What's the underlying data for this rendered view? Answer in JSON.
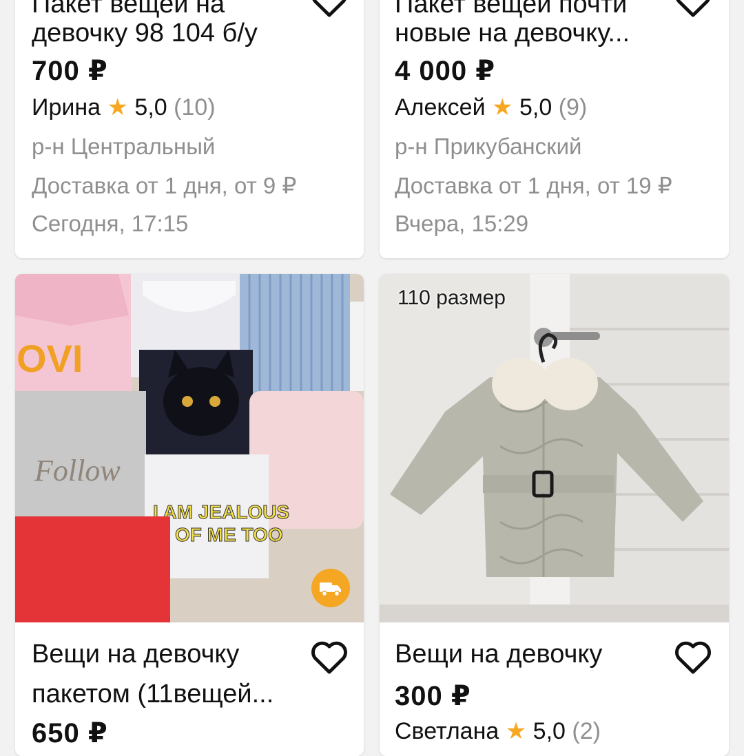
{
  "cards": [
    {
      "title_lines": [
        "Пакет вещей на",
        "девочку 98 104 б/у"
      ],
      "price": "700 ₽",
      "seller": "Ирина",
      "rating": "5,0",
      "reviews": "(10)",
      "district": "р-н Центральный",
      "delivery": "Доставка от 1 дня, от 9 ₽",
      "date": "Сегодня, 17:15"
    },
    {
      "title_lines": [
        "Пакет вещей почти",
        "новые на девочку..."
      ],
      "price": "4 000 ₽",
      "seller": "Алексей",
      "rating": "5,0",
      "reviews": "(9)",
      "district": "р-н Прикубанский",
      "delivery": "Доставка от 1 дня, от 19 ₽",
      "date": "Вчера, 15:29"
    },
    {
      "title_lines": [
        "Вещи на девочку",
        "пакетом (11вещей..."
      ],
      "price": "650 ₽",
      "photo_text": [
        "OVI",
        "Follow",
        "I AM JEALOUS",
        "OF ME TOO"
      ],
      "delivery_icon": "truck-icon"
    },
    {
      "title_lines": [
        "Вещи на девочку"
      ],
      "price": "300 ₽",
      "seller": "Светлана",
      "rating": "5,0",
      "reviews": "(2)",
      "photo_caption": "110 размер"
    }
  ],
  "colors": {
    "star": "#f7a823",
    "muted": "#8f8f8f",
    "delivery_badge": "#f5a623"
  },
  "icons": {
    "favorite": "heart-outline-icon",
    "rating": "star-icon",
    "delivery": "truck-icon"
  }
}
